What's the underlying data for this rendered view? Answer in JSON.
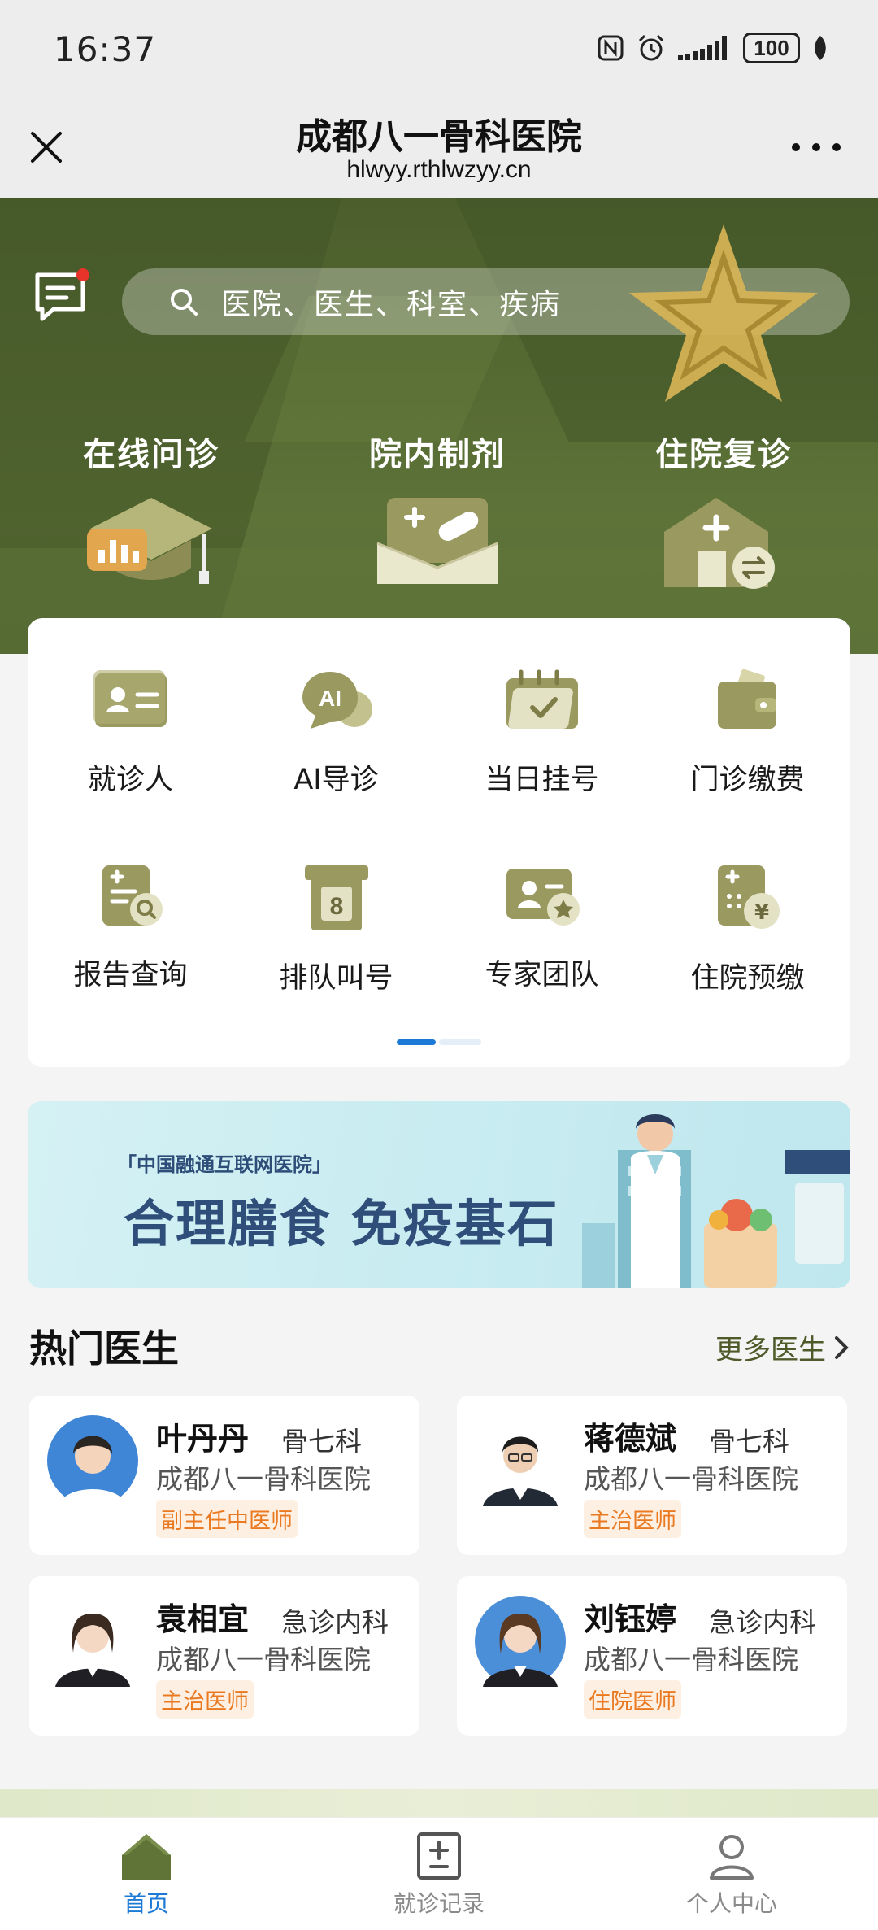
{
  "status_bar": {
    "time": "16:37",
    "battery": "100",
    "icons": [
      "nfc-icon",
      "alarm-icon",
      "signal-icon",
      "battery-icon",
      "leaf-icon"
    ]
  },
  "title_bar": {
    "title": "成都八一骨科医院",
    "url": "hlwyy.rthlwzyy.cn",
    "close_icon": "close-icon",
    "more_icon": "more-icon"
  },
  "hero": {
    "search_placeholder": "医院、医生、科室、疾病",
    "items": [
      {
        "label": "在线问诊",
        "icon": "graduation-cap-chart-icon"
      },
      {
        "label": "院内制剂",
        "icon": "medicine-box-icon"
      },
      {
        "label": "住院复诊",
        "icon": "house-medical-icon"
      }
    ],
    "colors": {
      "bg": "#4b5e2c",
      "accent_gold": "#d8b456"
    }
  },
  "services": {
    "items": [
      {
        "label": "就诊人",
        "icon": "id-card-icon"
      },
      {
        "label": "AI导诊",
        "icon": "ai-chat-icon"
      },
      {
        "label": "当日挂号",
        "icon": "calendar-check-icon"
      },
      {
        "label": "门诊缴费",
        "icon": "wallet-icon"
      },
      {
        "label": "报告查询",
        "icon": "report-search-icon"
      },
      {
        "label": "排队叫号",
        "icon": "queue-number-icon"
      },
      {
        "label": "专家团队",
        "icon": "expert-badge-icon"
      },
      {
        "label": "住院预缴",
        "icon": "prepay-yen-icon"
      }
    ],
    "page_indicator": {
      "current": 1,
      "total": 2
    }
  },
  "banner": {
    "tag": "「中国融通互联网医院」",
    "title": "合理膳食 免疫基石"
  },
  "hot_doctors": {
    "title": "热门医生",
    "more_label": "更多医生",
    "doctors": [
      {
        "name": "叶丹丹",
        "dept": "骨七科",
        "hospital": "成都八一骨科医院",
        "title": "副主任中医师"
      },
      {
        "name": "蒋德斌",
        "dept": "骨七科",
        "hospital": "成都八一骨科医院",
        "title": "主治医师"
      },
      {
        "name": "袁相宜",
        "dept": "急诊内科",
        "hospital": "成都八一骨科医院",
        "title": "主治医师"
      },
      {
        "name": "刘钰婷",
        "dept": "急诊内科",
        "hospital": "成都八一骨科医院",
        "title": "住院医师"
      }
    ]
  },
  "tabbar": {
    "tabs": [
      {
        "label": "首页",
        "icon": "home-icon",
        "active": true
      },
      {
        "label": "就诊记录",
        "icon": "records-icon",
        "active": false
      },
      {
        "label": "个人中心",
        "icon": "user-icon",
        "active": false
      }
    ],
    "colors": {
      "active": "#1d79d6",
      "inactive": "#8a8a8a"
    }
  }
}
